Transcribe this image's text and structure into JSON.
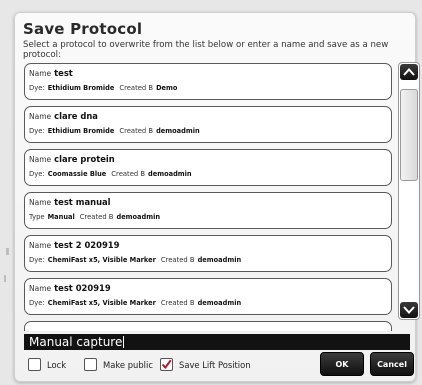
{
  "dialog": {
    "title": "Save Protocol",
    "subtitle": "Select a protocol to overwrite from the list below or enter a name and save as a new protocol:"
  },
  "protocols": [
    {
      "name_label": "Name",
      "name": "test",
      "type_label": "Dye:",
      "type": "Ethidium Bromide",
      "created_label": "Created B",
      "created_by": "Demo"
    },
    {
      "name_label": "Name",
      "name": "clare dna",
      "type_label": "Dye:",
      "type": "Ethidium Bromide",
      "created_label": "Created B",
      "created_by": "demoadmin"
    },
    {
      "name_label": "Name",
      "name": "clare protein",
      "type_label": "Dye:",
      "type": "Coomassie Blue",
      "created_label": "Created B",
      "created_by": "demoadmin"
    },
    {
      "name_label": "Name",
      "name": "test manual",
      "type_label": "Type",
      "type": "Manual",
      "created_label": "Created B",
      "created_by": "demoadmin"
    },
    {
      "name_label": "Name",
      "name": "test 2 020919",
      "type_label": "Dye:",
      "type": "ChemiFast x5, Visible Marker",
      "created_label": "Created B",
      "created_by": "demoadmin"
    },
    {
      "name_label": "Name",
      "name": "test 020919",
      "type_label": "Dye:",
      "type": "ChemiFast x5, Visible Marker",
      "created_label": "Created B",
      "created_by": "demoadmin"
    }
  ],
  "name_input": {
    "value": "Manual capture"
  },
  "options": {
    "lock": {
      "label": "Lock",
      "checked": false
    },
    "make_public": {
      "label": "Make public",
      "checked": false
    },
    "save_lift_position": {
      "label": "Save Lift Position",
      "checked": true
    }
  },
  "buttons": {
    "ok": "OK",
    "cancel": "Cancel"
  },
  "colors": {
    "check_mark": "#b0182a",
    "button_bg": "#1a1a1a",
    "input_bg": "#121212"
  }
}
